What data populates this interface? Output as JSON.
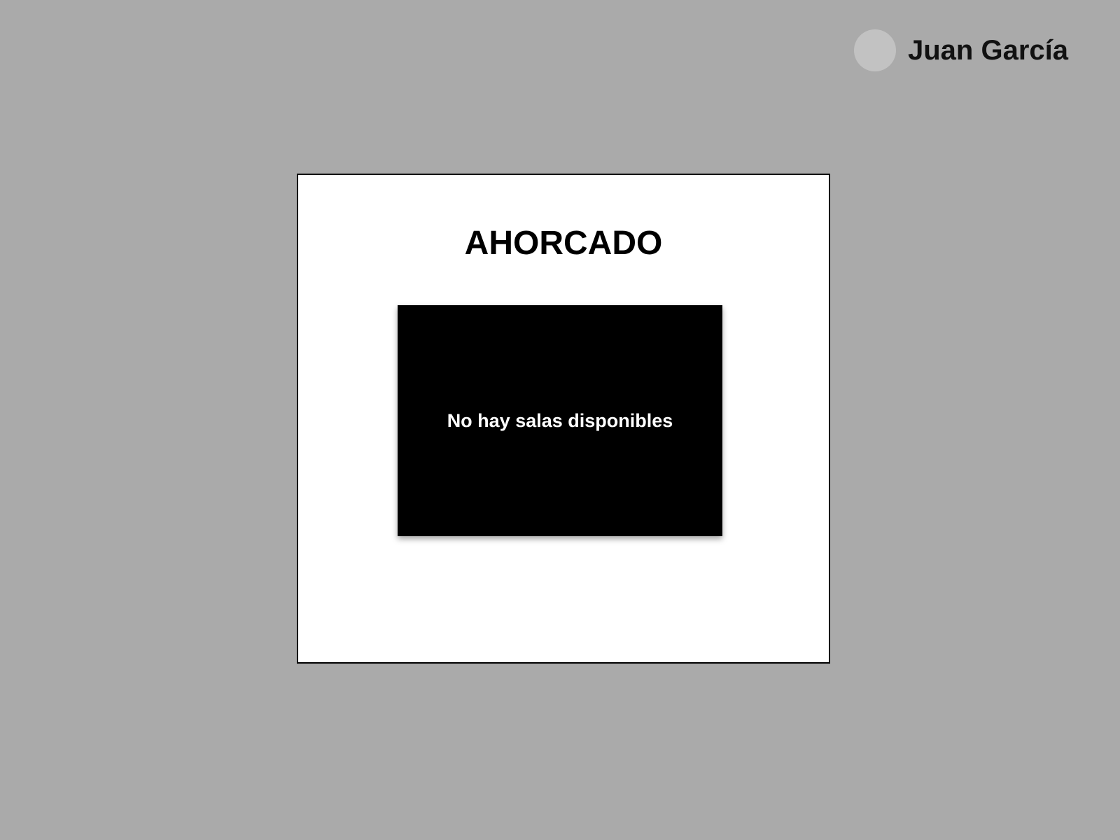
{
  "user": {
    "name": "Juan García"
  },
  "game": {
    "title": "AHORCADO"
  },
  "rooms": {
    "empty_message": "No hay salas disponibles"
  },
  "colors": {
    "background": "#aaaaaa",
    "card": "#ffffff",
    "panel": "#000000",
    "avatar": "#c2c2c2"
  }
}
